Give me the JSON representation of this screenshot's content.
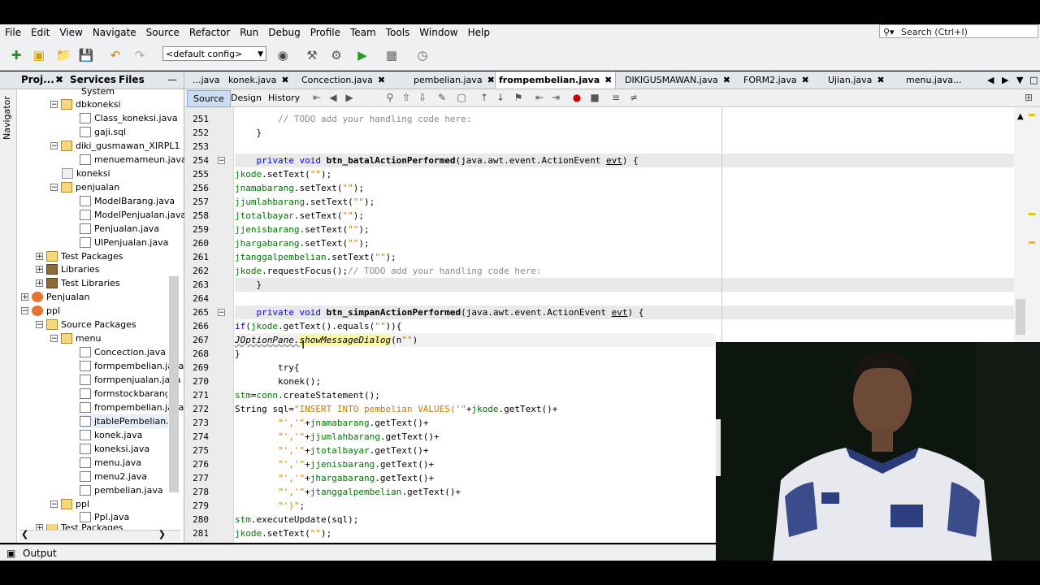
{
  "menubar": {
    "items": [
      "File",
      "Edit",
      "View",
      "Navigate",
      "Source",
      "Refactor",
      "Run",
      "Debug",
      "Profile",
      "Team",
      "Tools",
      "Window",
      "Help"
    ]
  },
  "search": {
    "placeholder": "Search (Ctrl+I)"
  },
  "toolbar": {
    "config": "<default config>"
  },
  "left_tabs": [
    "Proj...",
    "Services",
    "Files"
  ],
  "navigator_label": "Navigator",
  "tree": [
    {
      "label": "System",
      "type": "pkg"
    },
    {
      "label": "dbkoneksi",
      "type": "pkg"
    },
    {
      "label": "Class_koneksi.java",
      "type": "file"
    },
    {
      "label": "gaji.sql",
      "type": "file"
    },
    {
      "label": "diki_gusmawan_XIRPL1",
      "type": "pkg"
    },
    {
      "label": "menuemameun.java",
      "type": "file"
    },
    {
      "label": "koneksi",
      "type": "pkg"
    },
    {
      "label": "penjualan",
      "type": "pkg"
    },
    {
      "label": "ModelBarang.java",
      "type": "file"
    },
    {
      "label": "ModelPenjualan.java",
      "type": "file"
    },
    {
      "label": "Penjualan.java",
      "type": "file"
    },
    {
      "label": "UIPenjualan.java",
      "type": "file"
    },
    {
      "label": "Test Packages",
      "type": "pkg"
    },
    {
      "label": "Libraries",
      "type": "lib"
    },
    {
      "label": "Test Libraries",
      "type": "lib"
    },
    {
      "label": "Penjualan",
      "type": "proj"
    },
    {
      "label": "ppl",
      "type": "proj"
    },
    {
      "label": "Source Packages",
      "type": "pkg"
    },
    {
      "label": "menu",
      "type": "pkg"
    },
    {
      "label": "Concection.java",
      "type": "file"
    },
    {
      "label": "formpembelian.java",
      "type": "file"
    },
    {
      "label": "formpenjualan.java",
      "type": "file"
    },
    {
      "label": "formstockbarang.java",
      "type": "file"
    },
    {
      "label": "frompembelian.java",
      "type": "file"
    },
    {
      "label": "jtablePembelian.java",
      "type": "file"
    },
    {
      "label": "konek.java",
      "type": "file"
    },
    {
      "label": "koneksi.java",
      "type": "file"
    },
    {
      "label": "menu.java",
      "type": "file"
    },
    {
      "label": "menu2.java",
      "type": "file"
    },
    {
      "label": "pembelian.java",
      "type": "file"
    },
    {
      "label": "ppl",
      "type": "pkg"
    },
    {
      "label": "Ppl.java",
      "type": "file"
    },
    {
      "label": "Test Packages",
      "type": "pkg"
    }
  ],
  "editor_tabs": [
    "...java",
    "konek.java",
    "Concection.java",
    "pembelian.java",
    "frompembelian.java",
    "DIKIGUSMAWAN.java",
    "FORM2.java",
    "Ujian.java",
    "menu.java..."
  ],
  "editor_modes": [
    "Source",
    "Design",
    "History"
  ],
  "line_numbers": [
    "251",
    "252",
    "253",
    "254",
    "255",
    "256",
    "257",
    "258",
    "259",
    "260",
    "261",
    "262",
    "263",
    "264",
    "265",
    "266",
    "267",
    "268",
    "269",
    "270",
    "271",
    "272",
    "273",
    "274",
    "275",
    "276",
    "277",
    "278",
    "279",
    "280",
    "281"
  ],
  "code": {
    "l251": "        // TODO add your handling code here:",
    "l252": "    }",
    "l254a": "    private void ",
    "l254b": "btn_batalActionPerformed",
    "l254c": "(java.awt.event.ActionEvent ",
    "l254d": "evt",
    "l254e": ") {",
    "l255a": "jkode",
    "l255b": ".setText(",
    "l255c": "\"\"",
    "l255d": ");",
    "l256a": "jnamabarang",
    "l256b": ".setText(",
    "l256c": "\"\"",
    "l256d": ");",
    "l257a": "jjumlahbarang",
    "l257b": ".setText(",
    "l257c": "\"\"",
    "l257d": ");",
    "l258a": "jtotalbayar",
    "l258b": ".setText(",
    "l258c": "\"\"",
    "l258d": ");",
    "l259a": "jjenisbarang",
    "l259b": ".setText(",
    "l259c": "\"\"",
    "l259d": ");",
    "l260a": "jhargabarang",
    "l260b": ".setText(",
    "l260c": "\"\"",
    "l260d": ");",
    "l261a": "jtanggalpembelian",
    "l261b": ".setText(",
    "l261c": "\"\"",
    "l261d": ");",
    "l262a": "jkode",
    "l262b": ".requestFocus();",
    "l262c": "// TODO add your handling code here:",
    "l263": "    }",
    "l265a": "    private void ",
    "l265b": "btn_simpanActionPerformed",
    "l265c": "(java.awt.event.ActionEvent ",
    "l265d": "evt",
    "l265e": ") {",
    "l266a": "if(",
    "l266b": "jkode",
    "l266c": ".getText().equals(",
    "l266d": "\"\"",
    "l266e": ")){",
    "l267a": "JOptionPane.",
    "l267b": "showMessageDialog",
    "l267c": "(n",
    "l267d": "\"\"",
    "l267e": ")",
    "l268": "}",
    "l269": "        try{",
    "l270": "        konek();",
    "l271a": "stm",
    "l271b": "=",
    "l271c": "conn",
    "l271d": ".createStatement();",
    "l272a": "String sql=",
    "l272b": "\"INSERT INTO pembelian VALUES('\"",
    "l272c": "+",
    "l272d": "jkode",
    "l272e": ".getText()+",
    "l273a": "        ",
    "l273b": "\"','\"",
    "l273c": "+",
    "l273d": "jnamabarang",
    "l273e": ".getText()+",
    "l274a": "        ",
    "l274b": "\"','\"",
    "l274c": "+",
    "l274d": "jjumlahbarang",
    "l274e": ".getText()+",
    "l275a": "        ",
    "l275b": "\"','\"",
    "l275c": "+",
    "l275d": "jtotalbayar",
    "l275e": ".getText()+",
    "l276a": "        ",
    "l276b": "\"','\"",
    "l276c": "+",
    "l276d": "jjenisbarang",
    "l276e": ".getText()+",
    "l277a": "        ",
    "l277b": "\"','\"",
    "l277c": "+",
    "l277d": "jhargabarang",
    "l277e": ".getText()+",
    "l278a": "        ",
    "l278b": "\"','\"",
    "l278c": "+",
    "l278d": "jtanggalpembelian",
    "l278e": ".getText()+",
    "l279a": "        ",
    "l279b": "\"')\"",
    "l279c": ";",
    "l280a": "stm",
    "l280b": ".executeUpdate(sql);",
    "l281a": "jkode",
    "l281b": ".setText(",
    "l281c": "\"\"",
    "l281d": ");"
  },
  "output": {
    "label": "Output"
  },
  "colors": {
    "field": "#007700",
    "string": "#ce7b00",
    "comment": "#8a8a8a",
    "highlight": "#f9f5a0"
  }
}
